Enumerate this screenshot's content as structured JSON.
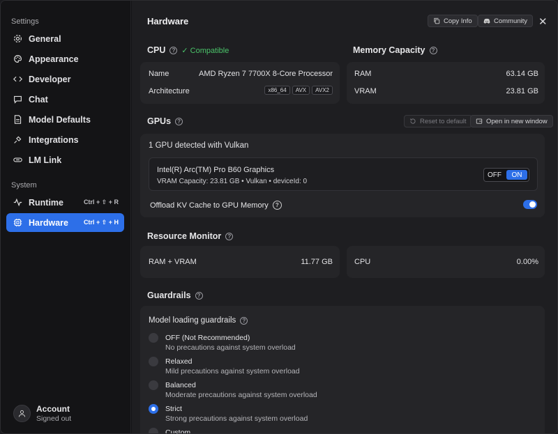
{
  "sidebar": {
    "settings_label": "Settings",
    "system_label": "System",
    "items": [
      {
        "label": "General"
      },
      {
        "label": "Appearance"
      },
      {
        "label": "Developer"
      },
      {
        "label": "Chat"
      },
      {
        "label": "Model Defaults"
      },
      {
        "label": "Integrations"
      },
      {
        "label": "LM Link"
      }
    ],
    "system_items": [
      {
        "label": "Runtime",
        "shortcut": "Ctrl + ⇧ + R"
      },
      {
        "label": "Hardware",
        "shortcut": "Ctrl + ⇧ + H",
        "active": true
      }
    ],
    "account": {
      "name": "Account",
      "status": "Signed out"
    }
  },
  "header": {
    "title": "Hardware",
    "copy_info_label": "Copy Info",
    "community_label": "Community",
    "close_glyph": "✕"
  },
  "cpu": {
    "title": "CPU",
    "status": "✓ Compatible",
    "name_label": "Name",
    "name_value": "AMD Ryzen 7 7700X 8-Core Processor",
    "arch_label": "Architecture",
    "arch_tags": [
      "x86_64",
      "AVX",
      "AVX2"
    ]
  },
  "memory": {
    "title": "Memory Capacity",
    "ram_label": "RAM",
    "ram_value": "63.14 GB",
    "vram_label": "VRAM",
    "vram_value": "23.81 GB"
  },
  "gpus": {
    "title": "GPUs",
    "reset_label": "Reset to default",
    "open_window_label": "Open in new window",
    "detected": "1 GPU detected with Vulkan",
    "gpu_name": "Intel(R) Arc(TM) Pro B60 Graphics",
    "gpu_details": "VRAM Capacity: 23.81 GB • Vulkan • deviceId: 0",
    "toggle_off": "OFF",
    "toggle_on": "ON",
    "offload_label": "Offload KV Cache to GPU Memory"
  },
  "resource_monitor": {
    "title": "Resource Monitor",
    "ram_vram_label": "RAM + VRAM",
    "ram_vram_value": "11.77 GB",
    "cpu_label": "CPU",
    "cpu_value": "0.00%"
  },
  "guardrails": {
    "title": "Guardrails",
    "subtitle": "Model loading guardrails",
    "options": [
      {
        "title": "OFF (Not Recommended)",
        "desc": "No precautions against system overload"
      },
      {
        "title": "Relaxed",
        "desc": "Mild precautions against system overload"
      },
      {
        "title": "Balanced",
        "desc": "Moderate precautions against system overload"
      },
      {
        "title": "Strict",
        "desc": "Strong precautions against system overload",
        "selected": true
      },
      {
        "title": "Custom",
        "desc": ""
      }
    ]
  },
  "colors": {
    "accent": "#2d6fe8",
    "compatible": "#4bc46a",
    "card": "#252528"
  }
}
